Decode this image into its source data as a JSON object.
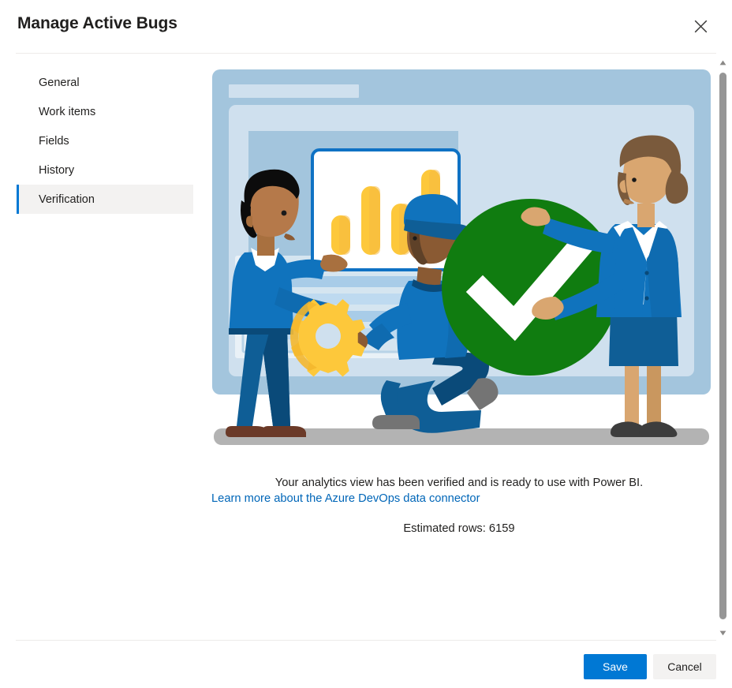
{
  "dialog": {
    "title": "Manage Active Bugs",
    "close_icon": "close-icon"
  },
  "sidebar": {
    "items": [
      {
        "label": "General",
        "selected": false
      },
      {
        "label": "Work items",
        "selected": false
      },
      {
        "label": "Fields",
        "selected": false
      },
      {
        "label": "History",
        "selected": false
      },
      {
        "label": "Verification",
        "selected": true
      }
    ]
  },
  "main": {
    "illustration_name": "analytics-verified-illustration",
    "status_message": "Your analytics view has been verified and is ready to use with Power BI.",
    "learn_more_link": "Learn more about the Azure DevOps data connector",
    "estimated_rows": "Estimated rows: 6159"
  },
  "scrollbar": {
    "up_icon": "chevron-up-icon",
    "down_icon": "chevron-down-icon"
  },
  "footer": {
    "save_label": "Save",
    "cancel_label": "Cancel"
  },
  "colors": {
    "accent": "#0078d4",
    "link": "#0066b8",
    "success": "#107c10",
    "selected_bg": "#f3f2f1",
    "divider": "#edebe9",
    "illus_panel_outer": "#a3c5dd",
    "illus_panel_inner": "#cfe0ee",
    "illus_accent_amber": "#fdc83b",
    "illus_floor": "#b3b3b3"
  }
}
